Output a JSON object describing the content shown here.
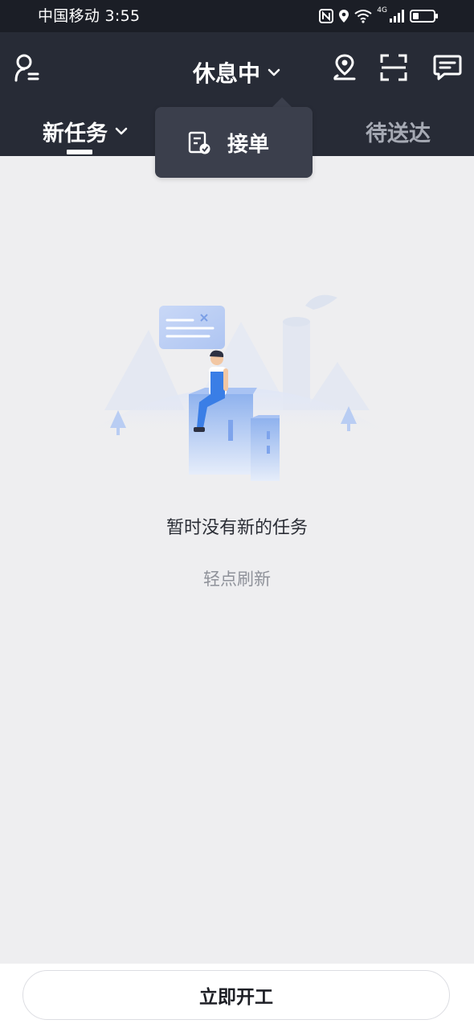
{
  "status_bar": {
    "carrier_time": "中国移动 3:55",
    "network_label": "4G"
  },
  "header": {
    "status_title": "休息中",
    "icons": [
      "profile-icon",
      "location-pin-icon",
      "scan-icon",
      "message-icon"
    ]
  },
  "tabs": {
    "active": "新任务",
    "inactive": "待送达"
  },
  "dropdown": {
    "item_label": "接单"
  },
  "empty_state": {
    "title": "暂时没有新的任务",
    "refresh": "轻点刷新"
  },
  "bottom_bar": {
    "start_button": "立即开工"
  },
  "colors": {
    "header_bg": "#272b36",
    "page_bg": "#eeeef0",
    "popup_bg": "#3b3f4c",
    "accent_blue": "#4a86e8"
  }
}
